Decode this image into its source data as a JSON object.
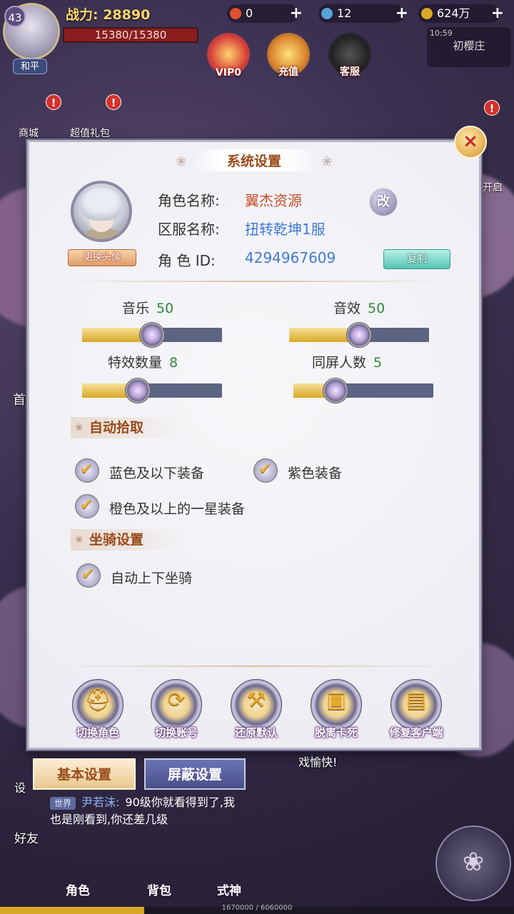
{
  "hud": {
    "level": "43",
    "mode": "和平",
    "power_label": "战力: 28890",
    "hp": "15380/15380",
    "res1": "0",
    "res2": "12",
    "res3": "624万",
    "time": "10:59",
    "map_name": "初樱庄",
    "vip": "VIP0",
    "recharge": "充值",
    "service": "客服",
    "side_shop": "商城",
    "side_gift": "超值礼包",
    "side_open": "开启",
    "side_first": "首",
    "badge": "!"
  },
  "dialog": {
    "title": "系统设置",
    "close": "×",
    "change_avatar": "更换头像",
    "role_name_label": "角色名称:",
    "role_name": "翼杰资源",
    "rename": "改",
    "server_label": "区服名称:",
    "server": "扭转乾坤1服",
    "role_id_label": "角 色 ID:",
    "role_id": "4294967609",
    "copy": "复制",
    "sliders": {
      "music": {
        "label": "音乐",
        "value": "50",
        "level": 0.5
      },
      "sfx": {
        "label": "音效",
        "value": "50",
        "level": 0.5
      },
      "effects": {
        "label": "特效数量",
        "value": "8",
        "level": 0.4
      },
      "players": {
        "label": "同屏人数",
        "value": "5",
        "level": 0.3
      }
    },
    "auto_pickup": "自动拾取",
    "opt_blue": "蓝色及以下装备",
    "opt_purple": "紫色装备",
    "opt_orange": "橙色及以上的一星装备",
    "mount_section": "坐骑设置",
    "opt_mount": "自动上下坐骑",
    "actions": [
      "切换角色",
      "切换账号",
      "还原默认",
      "脱离卡死",
      "修复客户端"
    ]
  },
  "tabs": {
    "basic": "基本设置",
    "block": "屏蔽设置"
  },
  "chat": {
    "line0": "戏愉快!",
    "channel": "世界",
    "name": "尹若沫:",
    "line1": "90级你就看得到了,我",
    "line2": "也是刚看到,你还差几级"
  },
  "bottom": {
    "set": "设",
    "friend": "好友",
    "role": "角色",
    "bag": "背包",
    "shikigami": "式神"
  },
  "xp": "1670000 / 6060000"
}
